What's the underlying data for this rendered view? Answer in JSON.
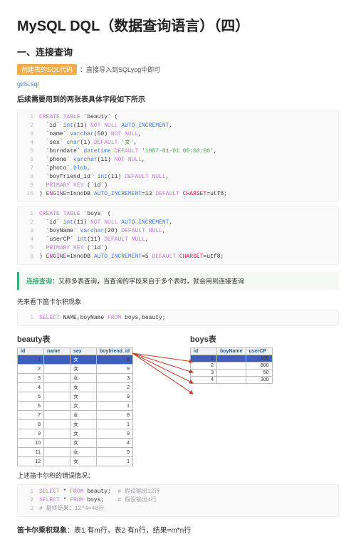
{
  "title": "MySQL DQL（数据查询语言）（四）",
  "section1": {
    "heading": "一、连接查询",
    "tag": "创建表的SQL代码",
    "after_tag": "：直接导入到SQLyog中即可",
    "filelink": "girls.sql",
    "note": "后续需要用到的两张表具体字段如下所示"
  },
  "code1": [
    {
      "n": "1",
      "t": "CREATE TABLE `beauty` ("
    },
    {
      "n": "2",
      "t": "  `id` int(11) NOT NULL AUTO_INCREMENT,"
    },
    {
      "n": "3",
      "t": "  `name` varchar(50) NOT NULL,"
    },
    {
      "n": "4",
      "t": "  `sex` char(1) DEFAULT '女',"
    },
    {
      "n": "5",
      "t": "  `borndate` datetime DEFAULT '1987-01-01 00:00:00',"
    },
    {
      "n": "6",
      "t": "  `phone` varchar(11) NOT NULL,"
    },
    {
      "n": "7",
      "t": "  `photo` blob,"
    },
    {
      "n": "8",
      "t": "  `boyfriend_id` int(11) DEFAULT NULL,"
    },
    {
      "n": "9",
      "t": "  PRIMARY KEY (`id`)"
    },
    {
      "n": "10",
      "t": ") ENGINE=InnoDB AUTO_INCREMENT=13 DEFAULT CHARSET=utf8;"
    }
  ],
  "code2": [
    {
      "n": "1",
      "t": "CREATE TABLE `boys` ("
    },
    {
      "n": "2",
      "t": "  `id` int(11) NOT NULL AUTO_INCREMENT,"
    },
    {
      "n": "3",
      "t": "  `boyName` varchar(20) DEFAULT NULL,"
    },
    {
      "n": "4",
      "t": "  `userCP` int(11) DEFAULT NULL,"
    },
    {
      "n": "5",
      "t": "  PRIMARY KEY (`id`)"
    },
    {
      "n": "6",
      "t": ") ENGINE=InnoDB AUTO_INCREMENT=5 DEFAULT CHARSET=utf8;"
    }
  ],
  "callout": {
    "tag": "连接查询",
    "text": "：又称多表查询，当查询的字段来自于多个表时，就会用到连接查询"
  },
  "pre_code3": "先来看下笛卡尔积现象",
  "code3": [
    {
      "n": "1",
      "t": "SELECT NAME,boyName FROM boys,beauty;"
    }
  ],
  "tbl_titles": {
    "beauty": "beauty表",
    "boys": "boys表"
  },
  "beauty": {
    "cols": [
      "id",
      "name",
      "sex",
      "boyfriend_id"
    ],
    "rows": [
      [
        "1",
        "",
        "女",
        "8"
      ],
      [
        "2",
        "",
        "女",
        "9"
      ],
      [
        "3",
        "",
        "女",
        "3"
      ],
      [
        "4",
        "",
        "女",
        "2"
      ],
      [
        "5",
        "",
        "女",
        "9"
      ],
      [
        "6",
        "",
        "女",
        "1"
      ],
      [
        "7",
        "",
        "女",
        "8"
      ],
      [
        "8",
        "",
        "女",
        "1"
      ],
      [
        "9",
        "",
        "女",
        "9"
      ],
      [
        "10",
        "",
        "女",
        "4"
      ],
      [
        "11",
        "",
        "女",
        "9"
      ],
      [
        "12",
        "",
        "女",
        "1"
      ]
    ]
  },
  "boys": {
    "cols": [
      "id",
      "boyName",
      "userCP"
    ],
    "rows": [
      [
        "1",
        "",
        "100"
      ],
      [
        "2",
        "",
        "800"
      ],
      [
        "3",
        "",
        "50"
      ],
      [
        "4",
        "",
        "300"
      ]
    ]
  },
  "mid_note": "上述笛卡尔积的错误情况：",
  "code4": [
    {
      "n": "1",
      "t": "SELECT * FROM beauty;  # 假设输出12行"
    },
    {
      "n": "2",
      "t": "SELECT * FROM boys;    # 假设输出4行"
    },
    {
      "n": "3",
      "t": "# 最终结果：12*4=48行"
    }
  ],
  "bottom": {
    "bold": "笛卡尔乘积现象",
    "rest": "：表1 有m行，表2 有n行，结果=m*n行"
  }
}
